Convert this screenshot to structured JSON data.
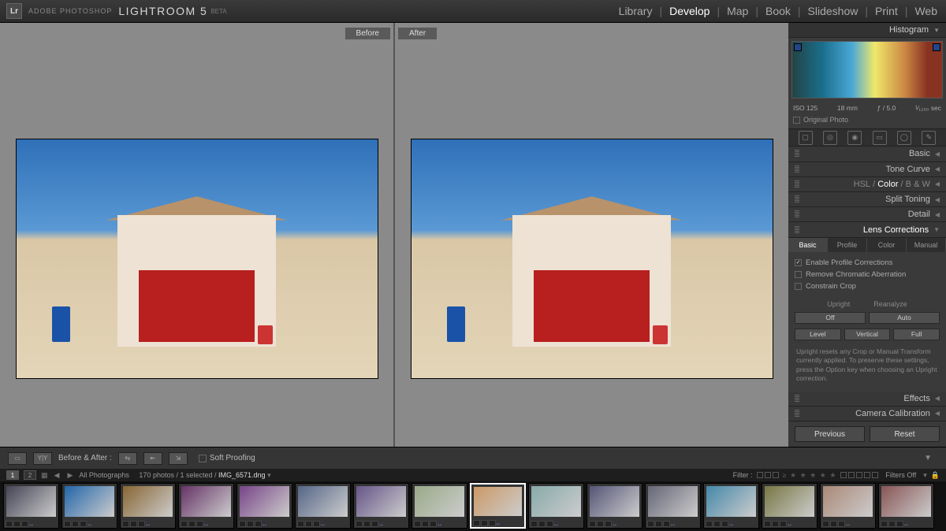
{
  "brand": {
    "logo": "Lr",
    "small": "ADOBE PHOTOSHOP",
    "main": "LIGHTROOM 5",
    "beta": "BETA"
  },
  "nav": {
    "items": [
      "Library",
      "Develop",
      "Map",
      "Book",
      "Slideshow",
      "Print",
      "Web"
    ],
    "active": "Develop"
  },
  "compare": {
    "before": "Before",
    "after": "After"
  },
  "right": {
    "histogram_label": "Histogram",
    "info": {
      "iso": "ISO 125",
      "focal": "18 mm",
      "aperture": "ƒ / 5.0",
      "shutter": "¹⁄₁₂₅₀ sec"
    },
    "original_photo": "Original Photo",
    "sections": {
      "basic": "Basic",
      "tone_curve": "Tone Curve",
      "hsl": "HSL",
      "color": "Color",
      "bw": "B & W",
      "split_toning": "Split Toning",
      "detail": "Detail",
      "lens_corrections": "Lens Corrections",
      "effects": "Effects",
      "camera_calibration": "Camera Calibration"
    },
    "lc": {
      "tabs": [
        "Basic",
        "Profile",
        "Color",
        "Manual"
      ],
      "active_tab": "Basic",
      "opts": {
        "enable_profile": "Enable Profile Corrections",
        "remove_ca": "Remove Chromatic Aberration",
        "constrain_crop": "Constrain Crop"
      },
      "upright_label": "Upright",
      "reanalyze": "Reanalyze",
      "buttons1": [
        "Off",
        "Auto"
      ],
      "buttons2": [
        "Level",
        "Vertical",
        "Full"
      ],
      "help": "Upright resets any Crop or Manual Transform currently applied. To preserve these settings, press the Option key when choosing an Upright correction."
    },
    "prev": "Previous",
    "reset": "Reset"
  },
  "bottombar": {
    "before_after": "Before & After :",
    "soft_proofing": "Soft Proofing"
  },
  "filmstrip_hdr": {
    "page1": "1",
    "page2": "2",
    "crumb_label": "All Photographs",
    "crumb_stats": "170 photos / 1 selected /",
    "crumb_file": "IMG_6571.dng",
    "filter_label": "Filter :",
    "filters_off": "Filters Off"
  },
  "thumbs": {
    "count": 16,
    "selected_index": 8
  }
}
